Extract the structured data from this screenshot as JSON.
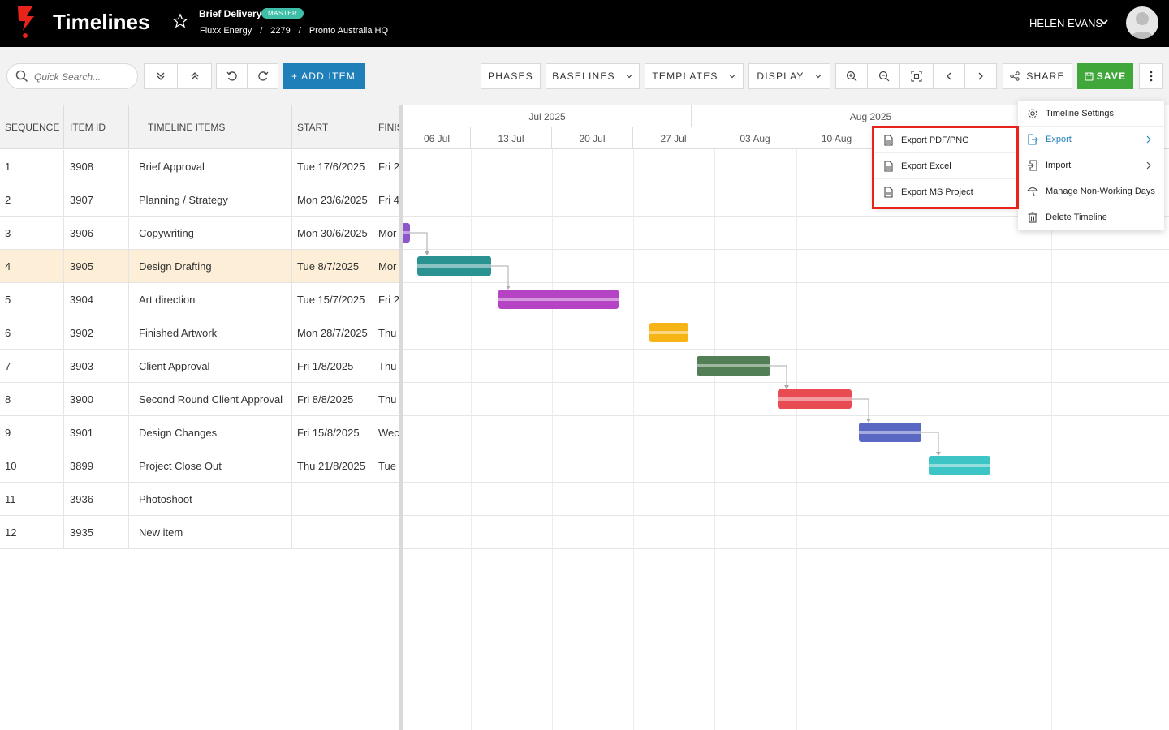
{
  "header": {
    "app_title": "Timelines",
    "project_name": "Brief Delivery",
    "badge": "MASTER",
    "breadcrumb": [
      "Fluxx Energy",
      "2279",
      "Pronto Australia HQ"
    ],
    "breadcrumb_separator": "/",
    "user_name": "HELEN EVANS",
    "brand_color": "#e8231a"
  },
  "toolbar": {
    "search_placeholder": "Quick Search...",
    "add_item_label": "+ ADD ITEM",
    "phases_label": "PHASES",
    "baselines_label": "BASELINES",
    "templates_label": "TEMPLATES",
    "display_label": "DISPLAY",
    "share_label": "SHARE",
    "save_label": "SAVE",
    "accent_color": "#1f7fb8",
    "save_color": "#40a83a"
  },
  "grid": {
    "columns": [
      "SEQUENCE",
      "ITEM ID",
      "TIMELINE ITEMS",
      "START",
      "FINISH"
    ],
    "selected_row": 4,
    "rows": [
      {
        "seq": "1",
        "id": "3908",
        "name": "Brief Approval",
        "start": "Tue 17/6/2025",
        "finish": "Fri 2"
      },
      {
        "seq": "2",
        "id": "3907",
        "name": "Planning / Strategy",
        "start": "Mon 23/6/2025",
        "finish": "Fri 4"
      },
      {
        "seq": "3",
        "id": "3906",
        "name": "Copywriting",
        "start": "Mon 30/6/2025",
        "finish": "Mor"
      },
      {
        "seq": "4",
        "id": "3905",
        "name": "Design Drafting",
        "start": "Tue 8/7/2025",
        "finish": "Mor"
      },
      {
        "seq": "5",
        "id": "3904",
        "name": "Art direction",
        "start": "Tue 15/7/2025",
        "finish": "Fri 2"
      },
      {
        "seq": "6",
        "id": "3902",
        "name": "Finished Artwork",
        "start": "Mon 28/7/2025",
        "finish": "Thu"
      },
      {
        "seq": "7",
        "id": "3903",
        "name": "Client Approval",
        "start": "Fri 1/8/2025",
        "finish": "Thu"
      },
      {
        "seq": "8",
        "id": "3900",
        "name": "Second Round Client Approval",
        "start": "Fri 8/8/2025",
        "finish": "Thu"
      },
      {
        "seq": "9",
        "id": "3901",
        "name": "Design Changes",
        "start": "Fri 15/8/2025",
        "finish": "Wec"
      },
      {
        "seq": "10",
        "id": "3899",
        "name": "Project Close Out",
        "start": "Thu 21/8/2025",
        "finish": "Tue"
      },
      {
        "seq": "11",
        "id": "3936",
        "name": "Photoshoot",
        "start": "",
        "finish": ""
      },
      {
        "seq": "12",
        "id": "3935",
        "name": "New item",
        "start": "",
        "finish": ""
      }
    ]
  },
  "gantt": {
    "months": [
      "Jul 2025",
      "Aug 2025"
    ],
    "weeks": [
      "06 Jul",
      "13 Jul",
      "20 Jul",
      "27 Jul",
      "03 Aug",
      "10 Aug"
    ],
    "bar_colors": {
      "copywriting": "#8e57c9",
      "design_drafting": "#2a9291",
      "art_direction": "#b444c4",
      "finished_artwork": "#f7b416",
      "client_approval": "#537f56",
      "second_round": "#e84c52",
      "design_changes": "#5a68c4",
      "project_close_out": "#3dc4c4"
    }
  },
  "menu": {
    "items": [
      {
        "label": "Timeline Settings",
        "icon": "gear-icon"
      },
      {
        "label": "Export",
        "icon": "export-icon"
      },
      {
        "label": "Import",
        "icon": "import-icon"
      },
      {
        "label": "Manage Non-Working Days",
        "icon": "umbrella-icon"
      },
      {
        "label": "Delete Timeline",
        "icon": "trash-icon"
      }
    ],
    "export_submenu": [
      {
        "label": "Export PDF/PNG",
        "icon": "file-icon"
      },
      {
        "label": "Export Excel",
        "icon": "file-icon"
      },
      {
        "label": "Export MS Project",
        "icon": "file-icon"
      }
    ],
    "highlight_color": "#e8231a"
  }
}
